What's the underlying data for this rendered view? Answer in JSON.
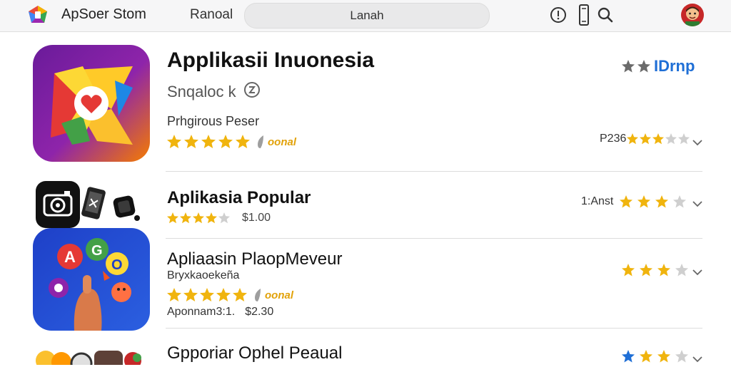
{
  "topbar": {
    "app_name": "ApSoer Stom",
    "nav_label": "Ranoal",
    "search_text": "Lanah"
  },
  "featured": {
    "title": "Applikasii Inuonesia",
    "subtitle": "Snqaloc k",
    "developer": "Prhgirous Peser",
    "rating_stars": 5,
    "badge": "oonal",
    "right_label": "IDrnp",
    "price_label": "P236",
    "right_rating": 3
  },
  "apps": [
    {
      "title": "Aplikasia Popular",
      "rating_stars": 4,
      "price": "$1.00",
      "right_label": "1:Anst",
      "right_rating": 3
    },
    {
      "title": "Apliaasin PlaopMeveur",
      "developer": "Bryxkaoekeña",
      "rating_stars": 5,
      "badge": "oonal",
      "meta": "Aponnam3:1.",
      "price": "$2.30",
      "right_rating": 3
    },
    {
      "title": "Gpporiar Ophel Peaual",
      "right_rating": 3
    }
  ],
  "colors": {
    "star_gold": "#f0b40e",
    "star_empty": "#cfcfcf",
    "accent_blue": "#1f6fd6",
    "gray_star": "#6b6b6b"
  }
}
